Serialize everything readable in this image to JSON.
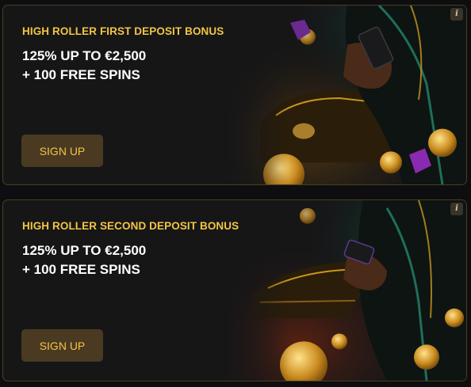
{
  "cards": [
    {
      "title": "HIGH ROLLER FIRST DEPOSIT BONUS",
      "offer_line1": "125% UP TO €2,500",
      "offer_line2": "+ 100 FREE SPINS",
      "button_label": "SIGN UP",
      "info_icon": "i"
    },
    {
      "title": "HIGH ROLLER SECOND DEPOSIT BONUS",
      "offer_line1": "125% UP TO €2,500",
      "offer_line2": "+ 100 FREE SPINS",
      "button_label": "SIGN UP",
      "info_icon": "i"
    }
  ],
  "colors": {
    "accent_gold": "#f2c544",
    "button_bg": "#4a3a22",
    "card_bg": "#161617",
    "card_border": "#4a3f22"
  },
  "icons": {
    "info": "info-icon",
    "illustration_1": "businessman-phone-car-coins",
    "illustration_2": "businessman-phone-yacht-coins"
  }
}
